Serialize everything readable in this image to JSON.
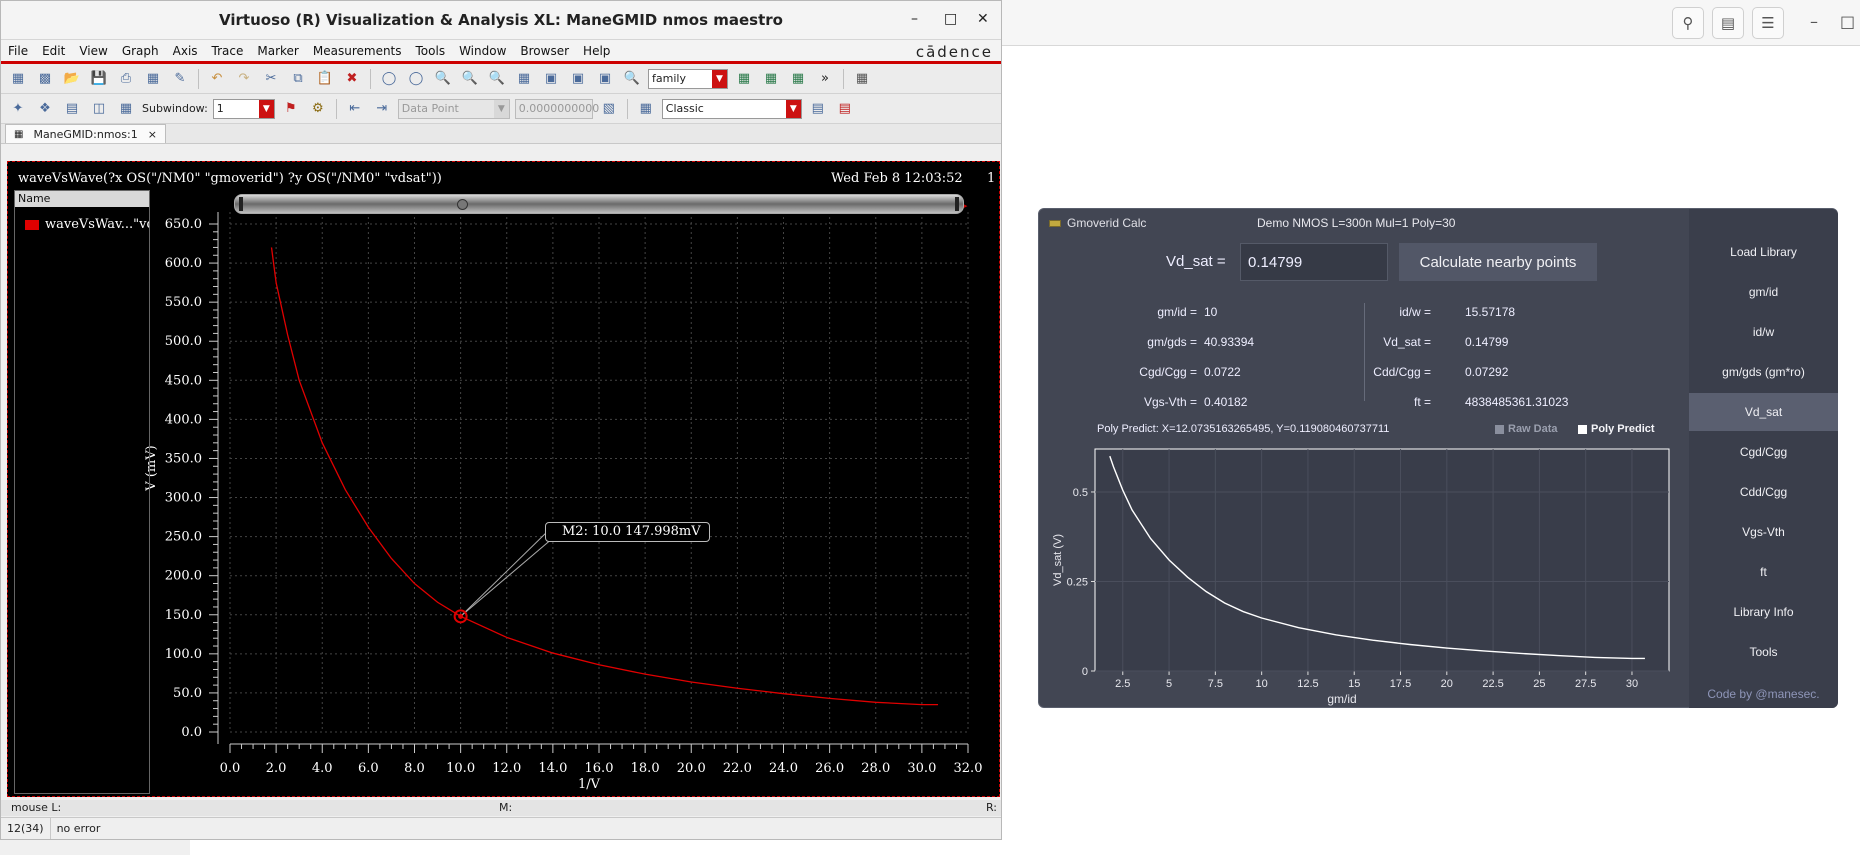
{
  "virtuoso": {
    "title": "Virtuoso (R) Visualization & Analysis XL: ManeGMID nmos maestro",
    "menu": [
      "File",
      "Edit",
      "View",
      "Graph",
      "Axis",
      "Trace",
      "Marker",
      "Measurements",
      "Tools",
      "Window",
      "Browser",
      "Help"
    ],
    "brand": "cādence",
    "family_combo": "family",
    "subwindow_label": "Subwindow:",
    "subwindow_value": "1",
    "datapoint_combo": "Data Point",
    "datapoint_value": "0.0000000000",
    "style_combo": "Classic",
    "tab_label": "ManeGMID:nmos:1",
    "tab_close": "×",
    "expression": "waveVsWave(?x OS(\"/NM0\" \"gmoverid\") ?y OS(\"/NM0\" \"vdsat\"))",
    "date": "Wed Feb 8 12:03:52",
    "page_no": "1",
    "legend_header": "Name",
    "legend_item": "waveVsWav...\"vd",
    "marker_label": "M2: 10.0 147.998mV",
    "status_mouse": "mouse L:",
    "status_m": "M:",
    "status_r": "R:",
    "status_count": "12(34)",
    "status_msg": "no error",
    "trace_color": "#e00000"
  },
  "chart_data": [
    {
      "type": "line",
      "xlabel": "1/V",
      "ylabel": "V (mV)",
      "xlim": [
        0,
        32
      ],
      "ylim": [
        0,
        650
      ],
      "x_ticks": [
        "0.0",
        "2.0",
        "4.0",
        "6.0",
        "8.0",
        "10.0",
        "12.0",
        "14.0",
        "16.0",
        "18.0",
        "20.0",
        "22.0",
        "24.0",
        "26.0",
        "28.0",
        "30.0",
        "32.0"
      ],
      "y_ticks": [
        "0.0",
        "50.0",
        "100.0",
        "150.0",
        "200.0",
        "250.0",
        "300.0",
        "350.0",
        "400.0",
        "450.0",
        "500.0",
        "550.0",
        "600.0",
        "650.0"
      ],
      "grid": true,
      "series": [
        {
          "x": [
            1.8,
            2,
            2.5,
            3,
            4,
            5,
            6,
            7,
            8,
            9,
            10,
            12,
            14,
            16,
            18,
            20,
            22,
            24,
            26,
            28,
            30,
            30.7
          ],
          "y": [
            620,
            575,
            508,
            450,
            370,
            310,
            262,
            222,
            190,
            166,
            148,
            121,
            101,
            86,
            74,
            64,
            56,
            49,
            43,
            38,
            35,
            35
          ]
        }
      ],
      "marker": {
        "x": 10.0,
        "y": 147.998
      }
    },
    {
      "type": "line",
      "xlabel": "gm/id",
      "ylabel": "Vd_sat (V)",
      "xlim": [
        1,
        32
      ],
      "ylim": [
        0,
        0.62
      ],
      "x_ticks": [
        "2.5",
        "5",
        "7.5",
        "10",
        "12.5",
        "15",
        "17.5",
        "20",
        "22.5",
        "25",
        "27.5",
        "30"
      ],
      "y_ticks": [
        "0",
        "0.25",
        "0.5"
      ],
      "series": [
        {
          "x": [
            1.8,
            2,
            2.5,
            3,
            4,
            5,
            6,
            7,
            8,
            9,
            10,
            12,
            14,
            16,
            18,
            20,
            22,
            24,
            26,
            28,
            30,
            30.7
          ],
          "y": [
            0.6,
            0.57,
            0.505,
            0.45,
            0.37,
            0.31,
            0.262,
            0.222,
            0.19,
            0.166,
            0.148,
            0.121,
            0.101,
            0.086,
            0.074,
            0.064,
            0.056,
            0.049,
            0.043,
            0.038,
            0.035,
            0.035
          ]
        }
      ]
    }
  ],
  "gmoverid": {
    "title": "Gmoverid Calc",
    "subtitle": "Demo  NMOS  L=300n  Mul=1  Poly=30",
    "close": "×",
    "vdsat_label": "Vd_sat =",
    "vdsat_value": "0.14799",
    "calc_button": "Calculate nearby points",
    "params_left": [
      {
        "label": "gm/id =",
        "value": "10"
      },
      {
        "label": "gm/gds =",
        "value": "40.93394"
      },
      {
        "label": "Cgd/Cgg =",
        "value": "0.0722"
      },
      {
        "label": "Vgs-Vth =",
        "value": "0.40182"
      }
    ],
    "params_right": [
      {
        "label": "id/w =",
        "value": "15.57178"
      },
      {
        "label": "Vd_sat =",
        "value": "0.14799"
      },
      {
        "label": "Cdd/Cgg =",
        "value": "0.07292"
      },
      {
        "label": "ft =",
        "value": "4838485361.31023"
      }
    ],
    "poly_text": "Poly Predict: X=12.0735163265495, Y=0.119080460737711",
    "raw_data": "Raw Data",
    "poly_predict": "Poly Predict",
    "sidebar": [
      "Load Library",
      "gm/id",
      "id/w",
      "gm/gds (gm*ro)",
      "Vd_sat",
      "Cgd/Cgg",
      "Cdd/Cgg",
      "Vgs-Vth",
      "ft",
      "Library Info",
      "Tools"
    ],
    "sidebar_active": "Vd_sat",
    "credit": "Code by @manesec."
  }
}
